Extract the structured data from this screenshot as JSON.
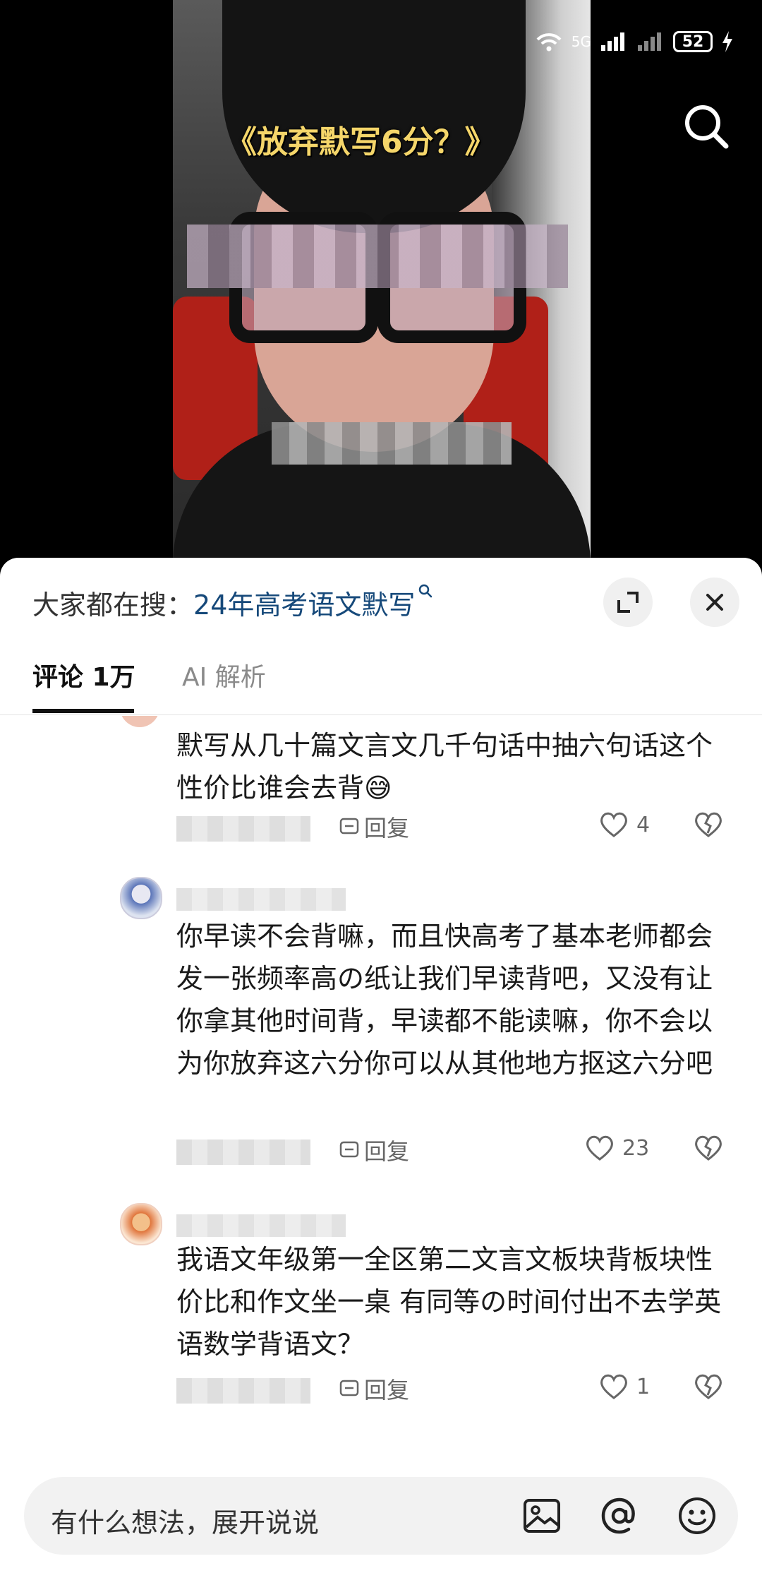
{
  "video": {
    "caption": "《放弃默写6分？》"
  },
  "status_bar": {
    "network": "5G",
    "battery": "52"
  },
  "sheet": {
    "trending_prefix": "大家都在搜：",
    "trending_term": "24年高考语文默写",
    "tabs": [
      {
        "label": "评论 1万",
        "active": true
      },
      {
        "label": "AI 解析",
        "active": false
      }
    ]
  },
  "comments": [
    {
      "text": "默写从几十篇文言文几千句话中抽六句话这个性价比谁会去背😅",
      "reply_label": "回复",
      "likes": "4"
    },
    {
      "text": "你早读不会背嘛，而且快高考了基本老师都会发一张频率高の纸让我们早读背吧，又没有让你拿其他时间背，早读都不能读嘛，你不会以为你放弃这六分你可以从其他地方抠这六分吧",
      "reply_label": "回复",
      "likes": "23"
    },
    {
      "text": "我语文年级第一全区第二文言文板块背板块性价比和作文坐一桌 有同等の时间付出不去学英语数学背语文？",
      "reply_label": "回复",
      "likes": "1"
    }
  ],
  "input": {
    "placeholder": "有什么想法，展开说说"
  }
}
